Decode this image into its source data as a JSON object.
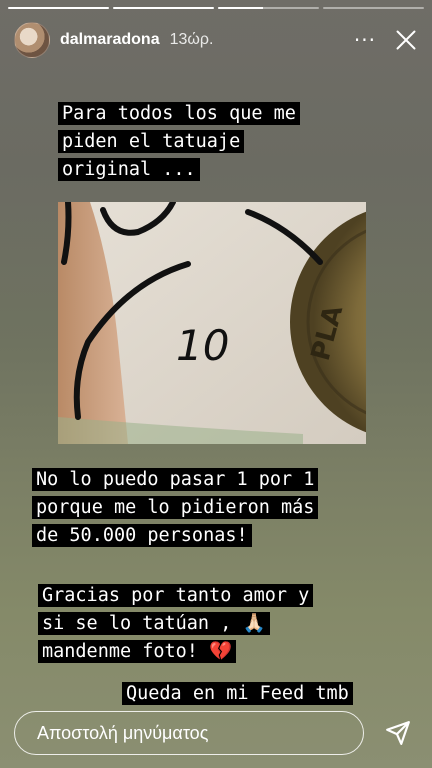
{
  "story": {
    "progress": [
      1.0,
      1.0,
      0.45,
      0.0
    ]
  },
  "header": {
    "username": "dalmaradona",
    "time": "13ώρ.",
    "more_label": "···"
  },
  "captions": {
    "top": [
      "Para todos los que me",
      "piden el tatuaje",
      "original ..."
    ],
    "middle": [
      "No lo puedo pasar 1 por 1",
      "porque me lo pidieron más",
      "de 50.000 personas!"
    ],
    "thanks": [
      "Gracias por tanto amor y",
      "si se lo tatúan , 🙏🏻",
      "mandenme foto! 💔"
    ],
    "feed": "Queda en mi Feed tmb"
  },
  "photo": {
    "tattoo_text": "10",
    "coin_text": "PLA"
  },
  "reply": {
    "placeholder": "Αποστολή μηνύματος"
  },
  "icons": {
    "close": "close-icon",
    "send": "send-icon"
  }
}
